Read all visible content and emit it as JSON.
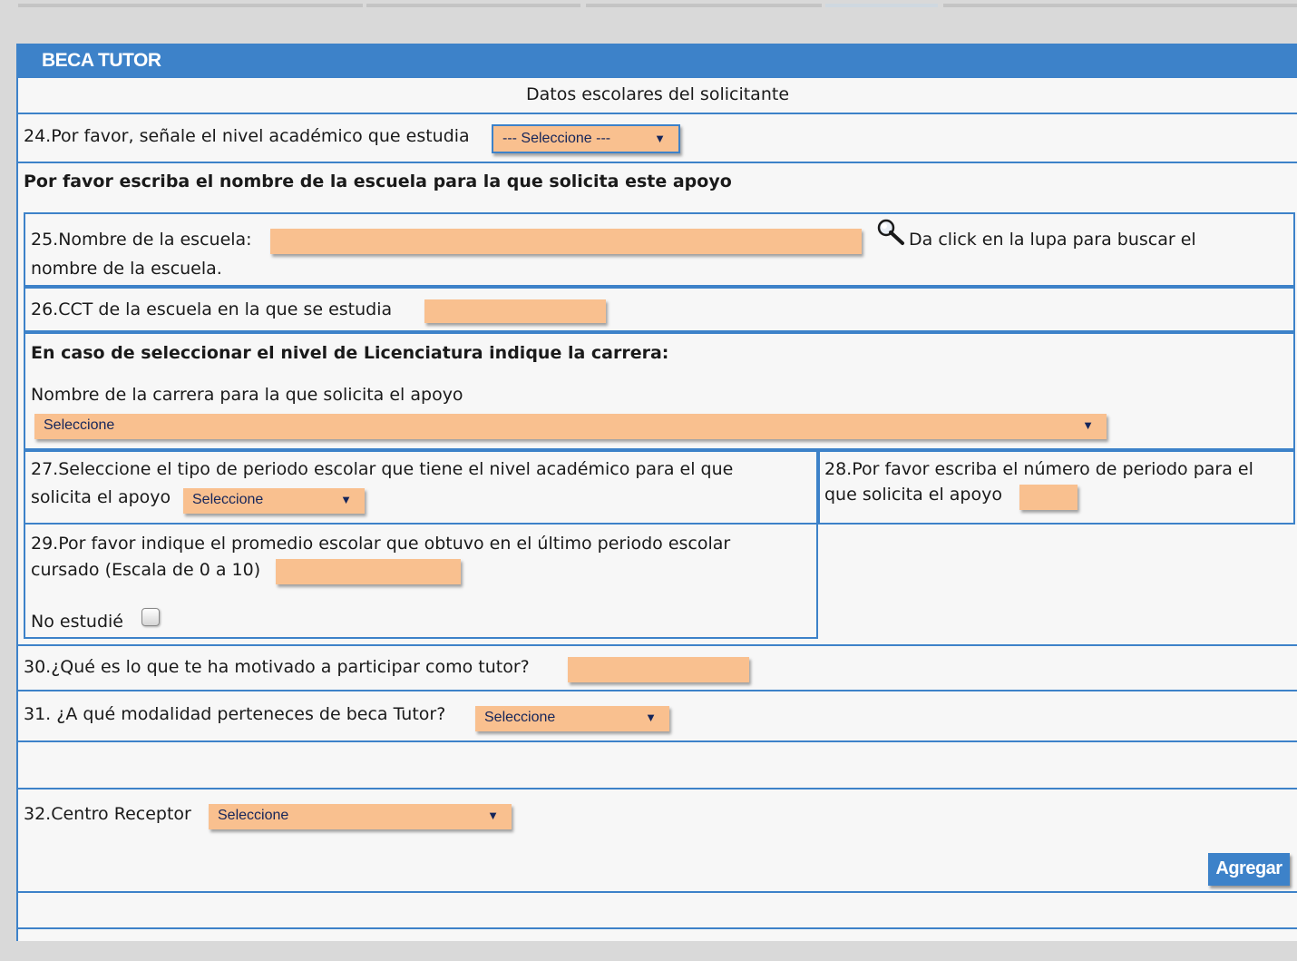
{
  "header": {
    "title": "BECA TUTOR"
  },
  "section": {
    "title": "Datos escolares del solicitante"
  },
  "q24": {
    "label": "24.Por favor, señale el nivel académico que estudia",
    "select_value": "--- Seleccione ---"
  },
  "school_heading": "Por favor escriba el nombre de la escuela para la que solicita este apoyo",
  "q25": {
    "label": "25.Nombre de la escuela:",
    "value": "",
    "hint_line1": "Da click en la lupa para buscar el",
    "hint_line2": "nombre de la escuela."
  },
  "q26": {
    "label": "26.CCT de la escuela en la que se estudia",
    "value": ""
  },
  "licenciatura": {
    "heading": "En caso de seleccionar el nivel de Licenciatura indique la carrera:",
    "label": "Nombre de la carrera para la que solicita el apoyo",
    "select_value": "Seleccione"
  },
  "q27": {
    "label_line1": "27.Seleccione el tipo de periodo escolar que tiene el nivel académico para el que",
    "label_line2": "solicita el apoyo",
    "select_value": "Seleccione"
  },
  "q28": {
    "label_line1": "28.Por favor escriba el número de periodo para el",
    "label_line2": "que solicita el apoyo",
    "value": ""
  },
  "q29": {
    "label_line1": "29.Por favor indique el promedio escolar que obtuvo en el último periodo escolar",
    "label_line2": "cursado (Escala de 0 a 10)",
    "value": "",
    "checkbox_label": "No estudié",
    "checkbox_checked": false
  },
  "q30": {
    "label": "30.¿Qué es lo que te ha motivado a participar como tutor?",
    "value": ""
  },
  "q31": {
    "label": "31. ¿A qué modalidad perteneces de beca Tutor?",
    "select_value": "Seleccione"
  },
  "q32": {
    "label": "32.Centro Receptor",
    "select_value": "Seleccione"
  },
  "actions": {
    "add_label": "Agregar"
  },
  "icons": {
    "search": "magnifier-icon",
    "dropdown": "triangle-down-icon"
  },
  "colors": {
    "accent": "#3d82c9",
    "field_bg": "#f9c08f",
    "panel_bg": "#f7f7f7",
    "page_bg": "#d9d9d9"
  }
}
